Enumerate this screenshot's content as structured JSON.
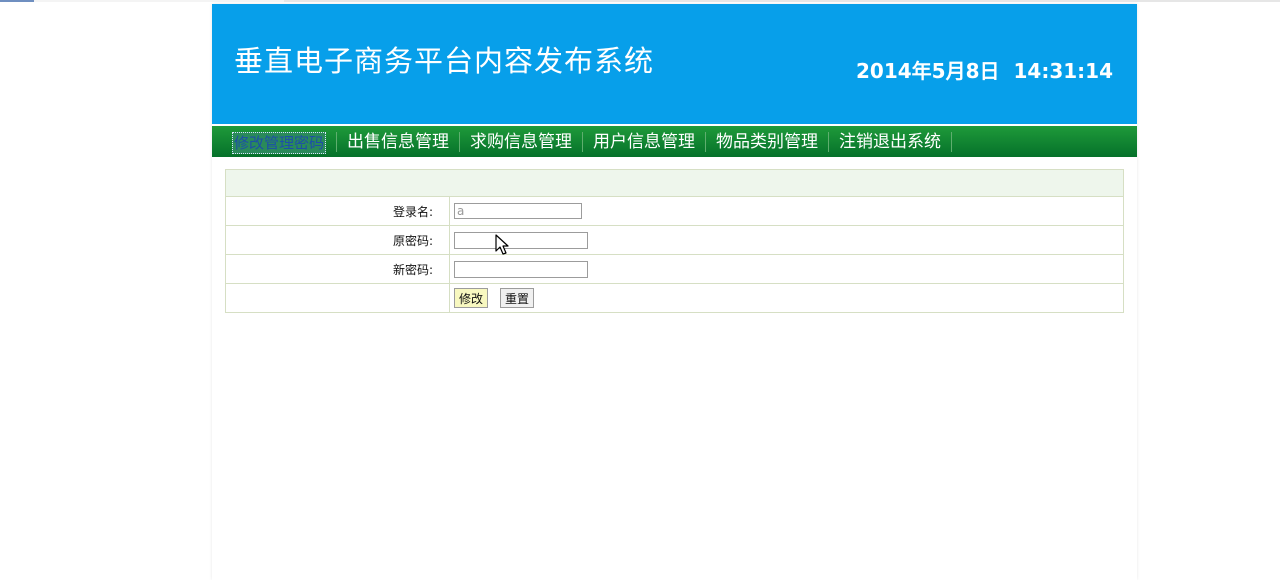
{
  "header": {
    "title": "垂直电子商务平台内容发布系统",
    "date": "2014年5月8日",
    "time": "14:31:14"
  },
  "nav": {
    "items": [
      {
        "label": "修改管理密码",
        "selected": true
      },
      {
        "label": "出售信息管理",
        "selected": false
      },
      {
        "label": "求购信息管理",
        "selected": false
      },
      {
        "label": "用户信息管理",
        "selected": false
      },
      {
        "label": "物品类别管理",
        "selected": false
      },
      {
        "label": "注销退出系统",
        "selected": false
      }
    ]
  },
  "form": {
    "login_name_label": "登录名:",
    "login_name_value": "a",
    "old_password_label": "原密码:",
    "old_password_value": "",
    "new_password_label": "新密码:",
    "new_password_value": "",
    "submit_label": "修改",
    "reset_label": "重置"
  }
}
